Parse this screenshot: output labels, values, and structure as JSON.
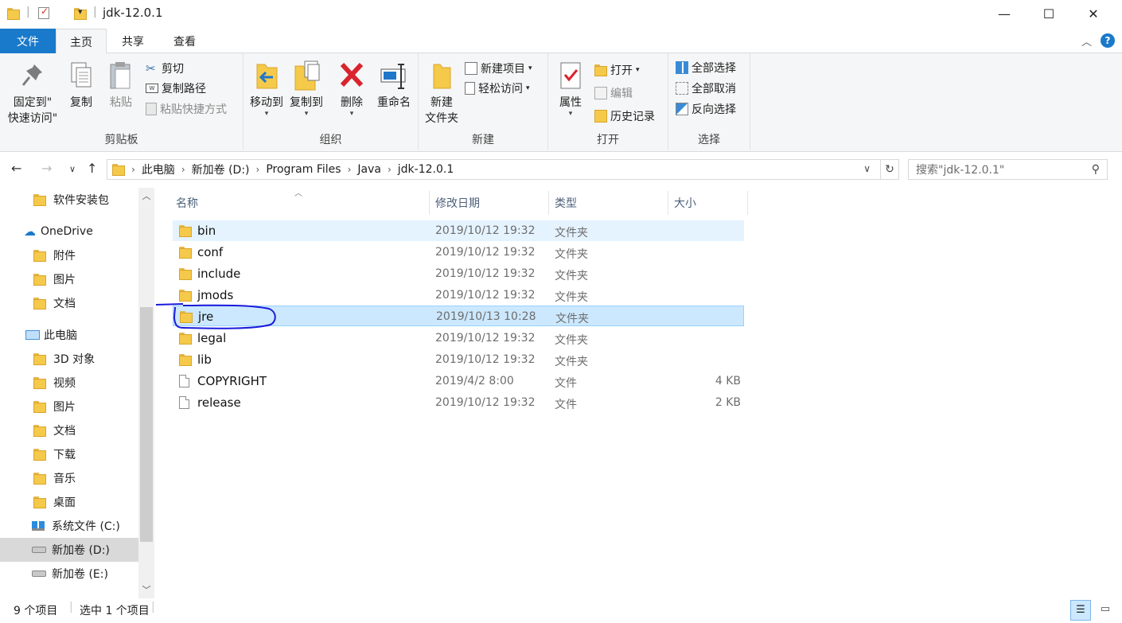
{
  "window": {
    "title": "jdk-12.0.1",
    "minimize": "—",
    "maximize": "☐",
    "close": "✕"
  },
  "tabs": {
    "file": "文件",
    "home": "主页",
    "share": "共享",
    "view": "查看"
  },
  "ribbon": {
    "clipboard": {
      "label": "剪贴板",
      "pin_line1": "固定到\"",
      "pin_line2": "快速访问\"",
      "copy": "复制",
      "paste": "粘贴",
      "cut": "剪切",
      "copy_path": "复制路径",
      "paste_shortcut": "粘贴快捷方式"
    },
    "organize": {
      "label": "组织",
      "move_to": "移动到",
      "copy_to": "复制到",
      "delete": "删除",
      "rename": "重命名"
    },
    "new": {
      "label": "新建",
      "new_folder_line1": "新建",
      "new_folder_line2": "文件夹",
      "new_item": "新建项目",
      "easy_access": "轻松访问"
    },
    "open": {
      "label": "打开",
      "properties": "属性",
      "open": "打开",
      "edit": "编辑",
      "history": "历史记录"
    },
    "select": {
      "label": "选择",
      "select_all": "全部选择",
      "select_none": "全部取消",
      "invert": "反向选择"
    }
  },
  "address": {
    "crumbs": [
      "此电脑",
      "新加卷 (D:)",
      "Program Files",
      "Java",
      "jdk-12.0.1"
    ],
    "search_placeholder": "搜索\"jdk-12.0.1\""
  },
  "sidebar": {
    "items": [
      {
        "label": "软件安装包",
        "icon": "folder-icon"
      },
      {
        "label": "OneDrive",
        "icon": "cloud-icon"
      },
      {
        "label": "附件",
        "icon": "folder-icon"
      },
      {
        "label": "图片",
        "icon": "folder-icon"
      },
      {
        "label": "文档",
        "icon": "folder-icon"
      },
      {
        "label": "此电脑",
        "icon": "computer-icon"
      },
      {
        "label": "3D 对象",
        "icon": "3d-objects-icon"
      },
      {
        "label": "视频",
        "icon": "video-icon"
      },
      {
        "label": "图片",
        "icon": "pictures-icon"
      },
      {
        "label": "文档",
        "icon": "documents-icon"
      },
      {
        "label": "下载",
        "icon": "download-icon"
      },
      {
        "label": "音乐",
        "icon": "music-icon"
      },
      {
        "label": "桌面",
        "icon": "desktop-icon"
      },
      {
        "label": "系统文件 (C:)",
        "icon": "windows-drive-icon"
      },
      {
        "label": "新加卷 (D:)",
        "icon": "drive-icon"
      },
      {
        "label": "新加卷 (E:)",
        "icon": "drive-icon"
      }
    ]
  },
  "columns": {
    "name": "名称",
    "date": "修改日期",
    "type": "类型",
    "size": "大小"
  },
  "files": [
    {
      "name": "bin",
      "date": "2019/10/12 19:32",
      "type": "文件夹",
      "size": "",
      "kind": "folder"
    },
    {
      "name": "conf",
      "date": "2019/10/12 19:32",
      "type": "文件夹",
      "size": "",
      "kind": "folder"
    },
    {
      "name": "include",
      "date": "2019/10/12 19:32",
      "type": "文件夹",
      "size": "",
      "kind": "folder"
    },
    {
      "name": "jmods",
      "date": "2019/10/12 19:32",
      "type": "文件夹",
      "size": "",
      "kind": "folder"
    },
    {
      "name": "jre",
      "date": "2019/10/13 10:28",
      "type": "文件夹",
      "size": "",
      "kind": "folder"
    },
    {
      "name": "legal",
      "date": "2019/10/12 19:32",
      "type": "文件夹",
      "size": "",
      "kind": "folder"
    },
    {
      "name": "lib",
      "date": "2019/10/12 19:32",
      "type": "文件夹",
      "size": "",
      "kind": "folder"
    },
    {
      "name": "COPYRIGHT",
      "date": "2019/4/2 8:00",
      "type": "文件",
      "size": "4 KB",
      "kind": "file"
    },
    {
      "name": "release",
      "date": "2019/10/12 19:32",
      "type": "文件",
      "size": "2 KB",
      "kind": "file"
    }
  ],
  "status": {
    "count": "9 个项目",
    "selected": "选中 1 个项目"
  },
  "colors": {
    "accent": "#1979ca",
    "selection": "#cce8ff",
    "hover": "#e5f3ff",
    "annotation": "#1a1adb"
  }
}
